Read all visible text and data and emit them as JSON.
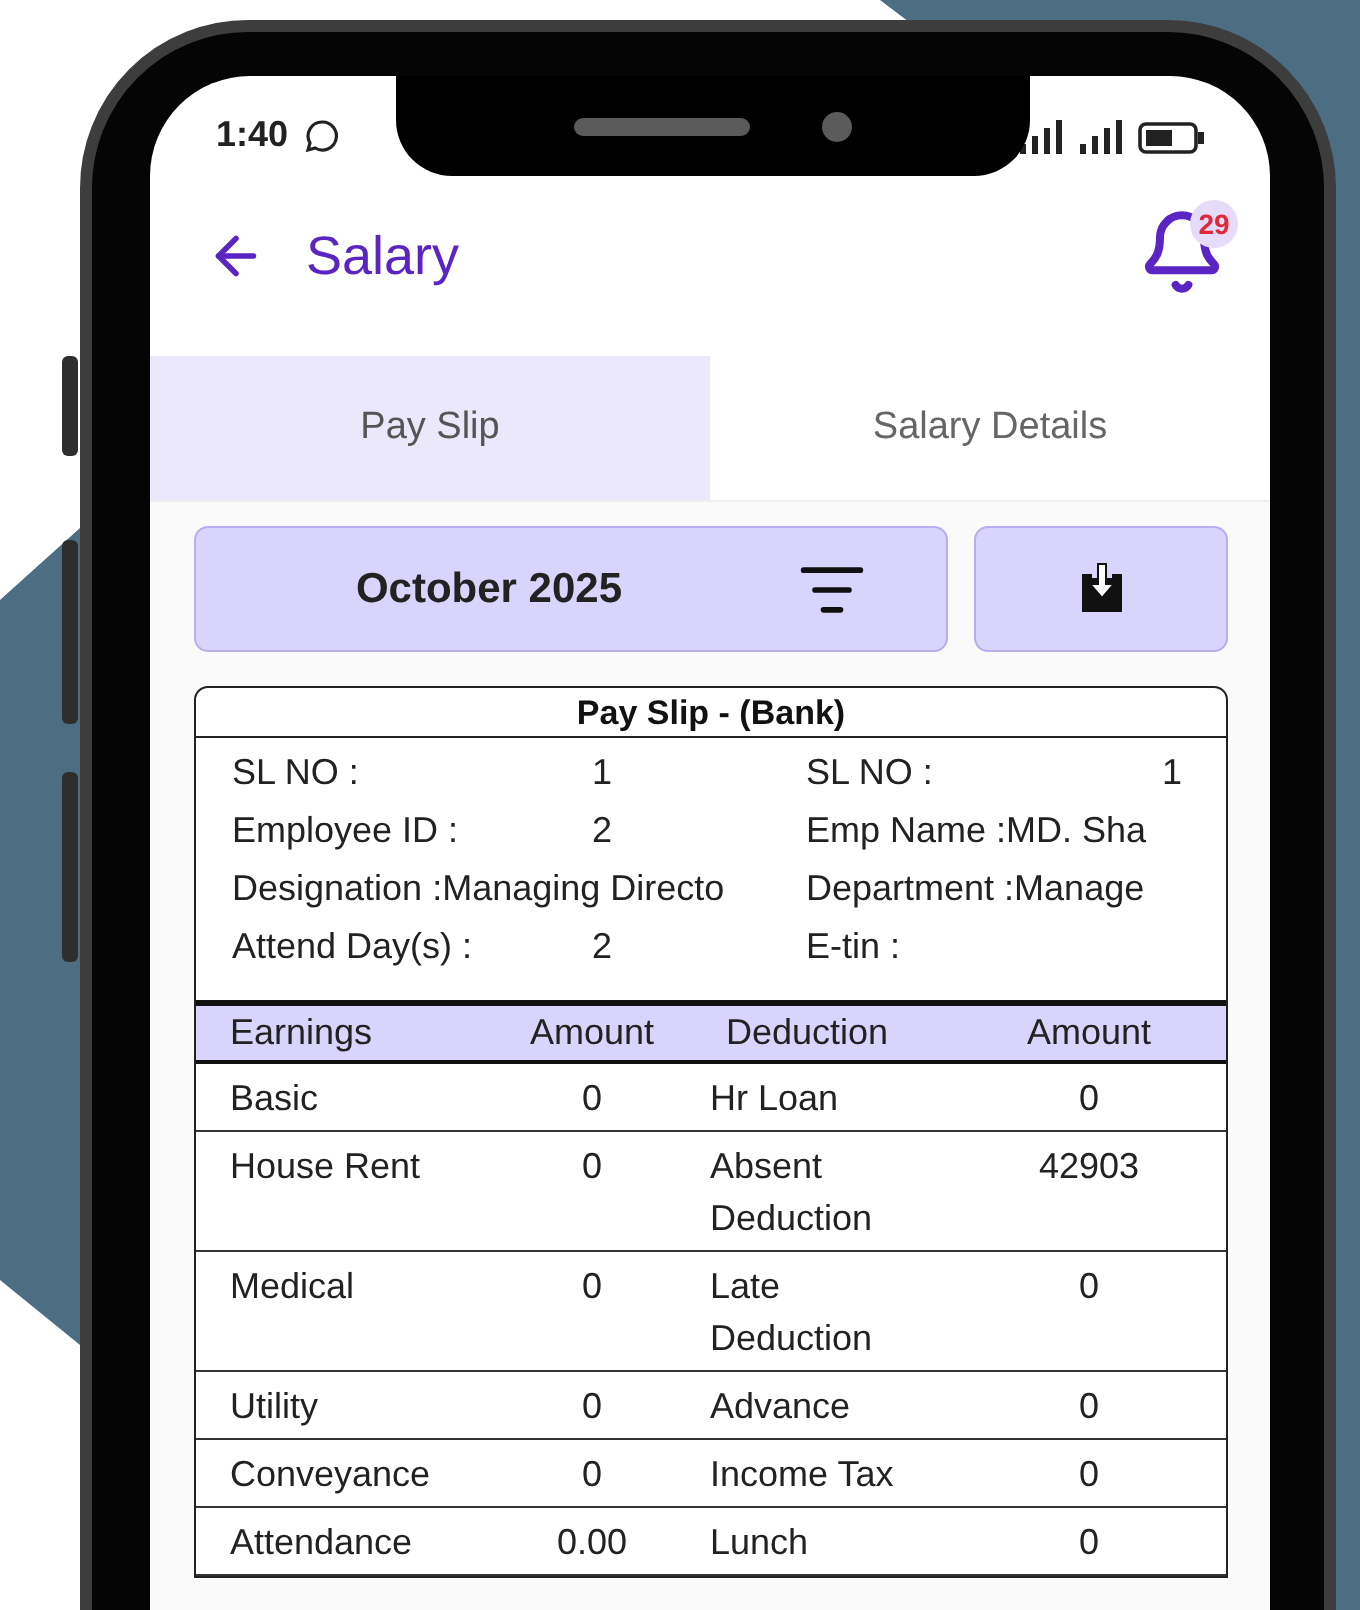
{
  "status_bar": {
    "time": "1:40"
  },
  "header": {
    "title": "Salary",
    "notification_count": "29"
  },
  "tabs": [
    {
      "label": "Pay Slip",
      "selected": true
    },
    {
      "label": "Salary Details",
      "selected": false
    }
  ],
  "period": {
    "label": "October 2025"
  },
  "payslip": {
    "title": "Pay Slip - (Bank)",
    "fields": [
      {
        "label": "SL NO :",
        "value": "1",
        "kind": "aligned"
      },
      {
        "label": "SL NO :",
        "value": "1",
        "kind": "aligned"
      },
      {
        "label": "Employee ID :",
        "value": "2",
        "kind": "aligned"
      },
      {
        "label": "Emp Name :",
        "value": "MD. Sha",
        "kind": "inline"
      },
      {
        "label": "Designation :",
        "value": "Managing Directo",
        "kind": "inline"
      },
      {
        "label": "Department :",
        "value": "Manage",
        "kind": "inline"
      },
      {
        "label": "Attend Day(s) :",
        "value": "2",
        "kind": "aligned"
      },
      {
        "label": "E-tin :",
        "kind": "inline"
      }
    ],
    "columns": [
      "Earnings",
      "Amount",
      "Deduction",
      "Amount"
    ],
    "rows": [
      [
        "Basic",
        "0",
        "Hr Loan",
        "0"
      ],
      [
        "House Rent",
        "0",
        "Absent Deduction",
        "42903"
      ],
      [
        "Medical",
        "0",
        "Late Deduction",
        "0"
      ],
      [
        "Utility",
        "0",
        "Advance",
        "0"
      ],
      [
        "Conveyance",
        "0",
        "Income Tax",
        "0"
      ],
      [
        "Attendance",
        "0.00",
        "Lunch",
        "0"
      ]
    ]
  }
}
